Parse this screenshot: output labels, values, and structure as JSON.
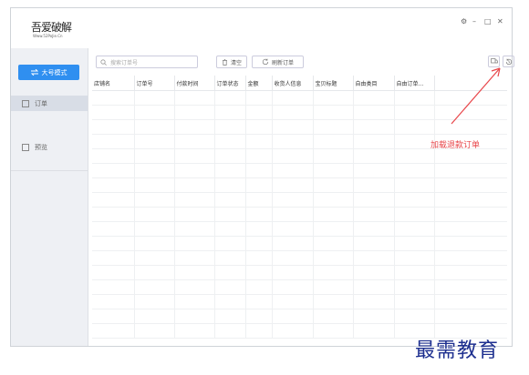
{
  "app": {
    "logo_main": "吾爱破解",
    "logo_sub": "Www.52PoJie.Cn"
  },
  "window_controls": {
    "settings": "⚙",
    "minimize": "–",
    "maximize": "□",
    "close": "✕"
  },
  "sidebar": {
    "big_button_label": "大号模式",
    "items": [
      {
        "label": "订单"
      },
      {
        "label": "预览"
      }
    ]
  },
  "toolbar": {
    "search_placeholder": "搜索订单号",
    "clear_label": "清空",
    "refresh_label": "刷新订单"
  },
  "table": {
    "columns": [
      "店铺名",
      "订单号",
      "付款时间",
      "订单状态",
      "金额",
      "收货人信息",
      "宝贝标题",
      "自由类目",
      "自由订单..."
    ]
  },
  "annotation": {
    "text": "加载退款订单",
    "color": "#e8464a"
  },
  "watermark": {
    "text": "最需教育"
  }
}
